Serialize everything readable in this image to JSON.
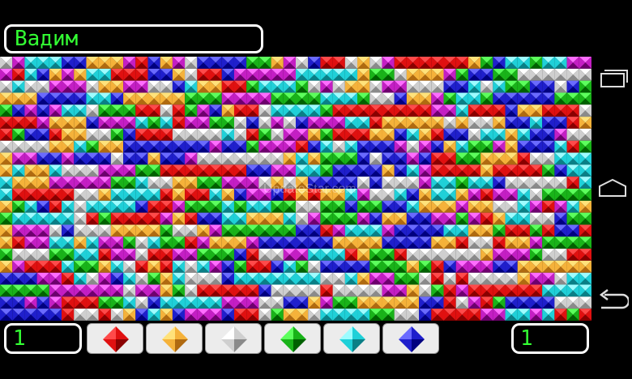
{
  "player": {
    "name": "Вадим"
  },
  "board": {
    "cols": 48,
    "rows": 22,
    "seed": 12345
  },
  "palette": [
    {
      "name": "red",
      "light": "#ff4a4a",
      "mid": "#e01010",
      "dark": "#8a0000"
    },
    {
      "name": "yellow",
      "light": "#ffe27a",
      "mid": "#f5b23a",
      "dark": "#b06a10"
    },
    {
      "name": "white",
      "light": "#ffffff",
      "mid": "#cfcfcf",
      "dark": "#8a8a8a"
    },
    {
      "name": "green",
      "light": "#5cff5c",
      "mid": "#19b319",
      "dark": "#006100"
    },
    {
      "name": "cyan",
      "light": "#9dfcff",
      "mid": "#1fd0d8",
      "dark": "#0a7f86"
    },
    {
      "name": "blue",
      "light": "#6a6aff",
      "mid": "#1f1fcc",
      "dark": "#000080"
    },
    {
      "name": "magenta",
      "light": "#ff6cff",
      "mid": "#c41ec4",
      "dark": "#6e006e"
    }
  ],
  "counters": {
    "left": "1",
    "right": "1"
  },
  "watermark": "UpdateStar.com"
}
